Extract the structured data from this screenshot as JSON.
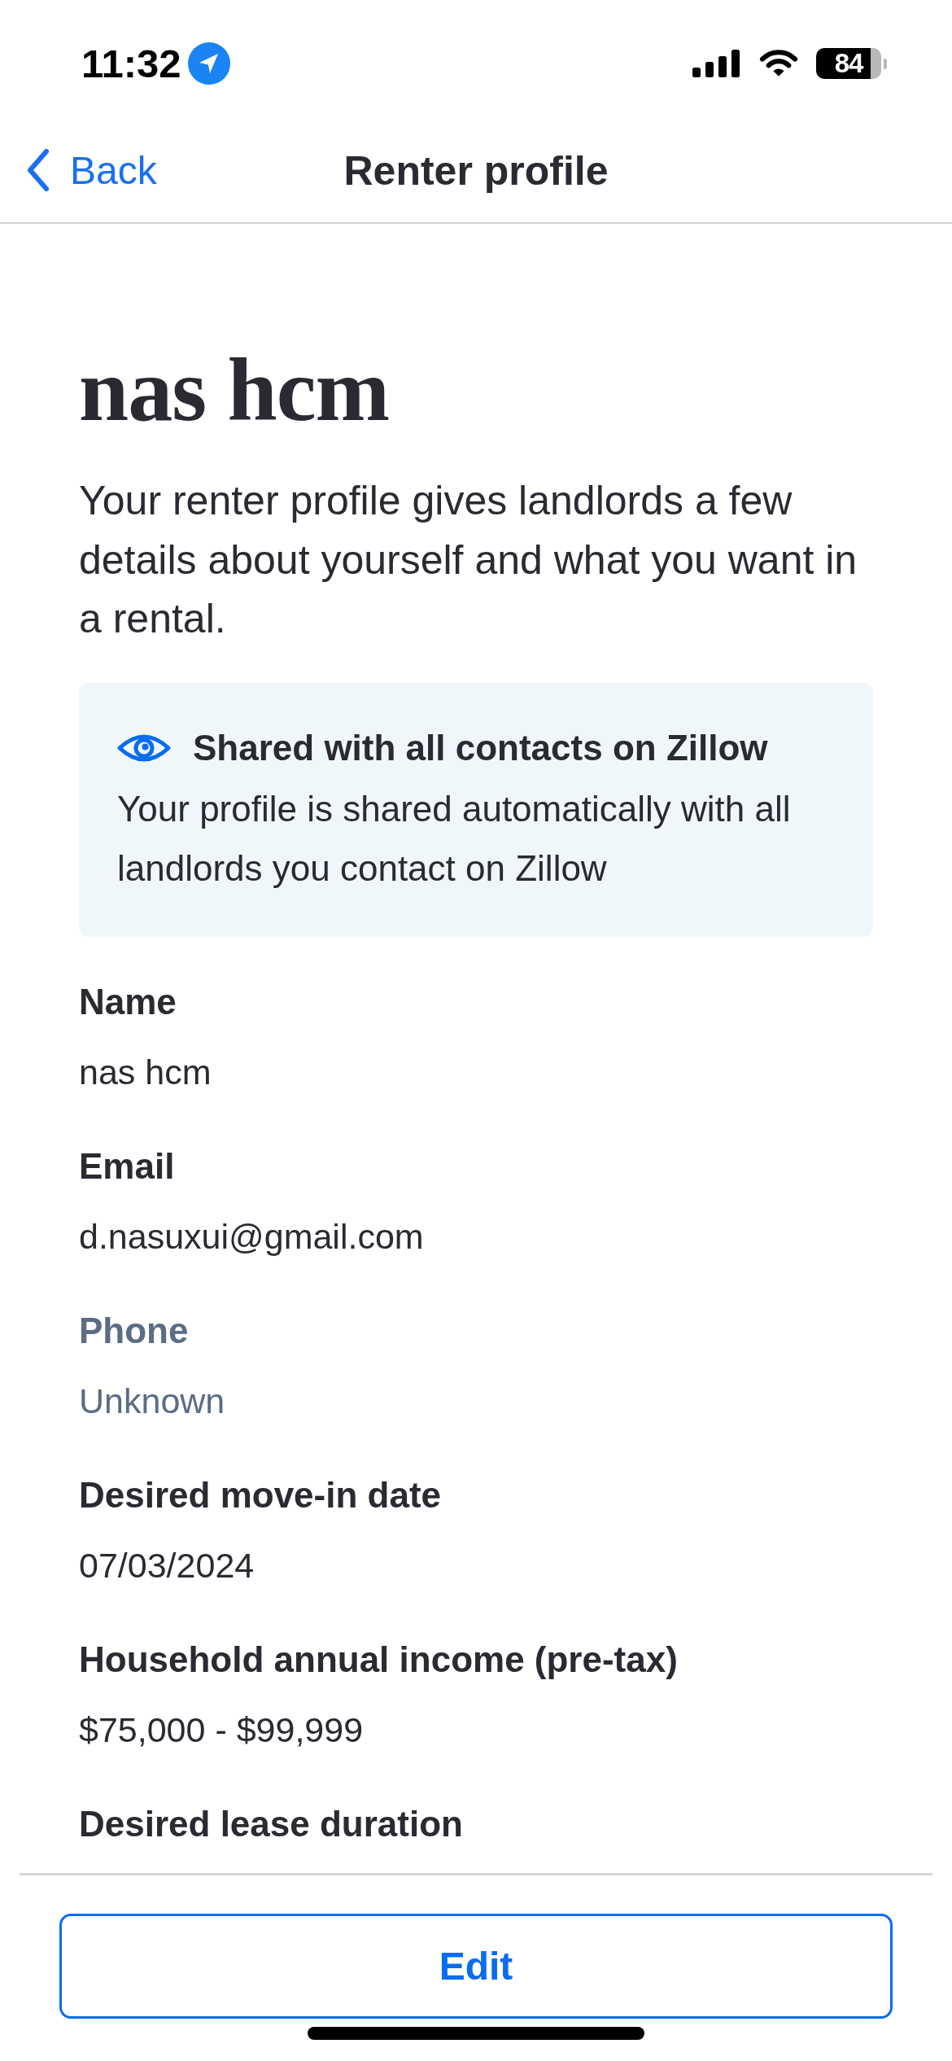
{
  "status_bar": {
    "time": "11:32",
    "battery": "84"
  },
  "nav": {
    "back": "Back",
    "title": "Renter profile"
  },
  "profile": {
    "name": "nas hcm",
    "intro": "Your renter profile gives landlords a few details about yourself and what you want in a rental."
  },
  "notice": {
    "title": "Shared with all contacts on Zillow",
    "text": "Your profile is shared automatically with all landlords you contact on Zillow"
  },
  "fields": [
    {
      "label": "Name",
      "value": "nas hcm",
      "muted": false
    },
    {
      "label": "Email",
      "value": "d.nasuxui@gmail.com",
      "muted": false
    },
    {
      "label": "Phone",
      "value": "Unknown",
      "muted": true
    },
    {
      "label": "Desired move-in date",
      "value": "07/03/2024",
      "muted": false
    },
    {
      "label": "Household annual income (pre-tax)",
      "value": "$75,000 - $99,999",
      "muted": false
    },
    {
      "label": "Desired lease duration",
      "muted": false
    }
  ],
  "footer": {
    "button": "Edit"
  }
}
